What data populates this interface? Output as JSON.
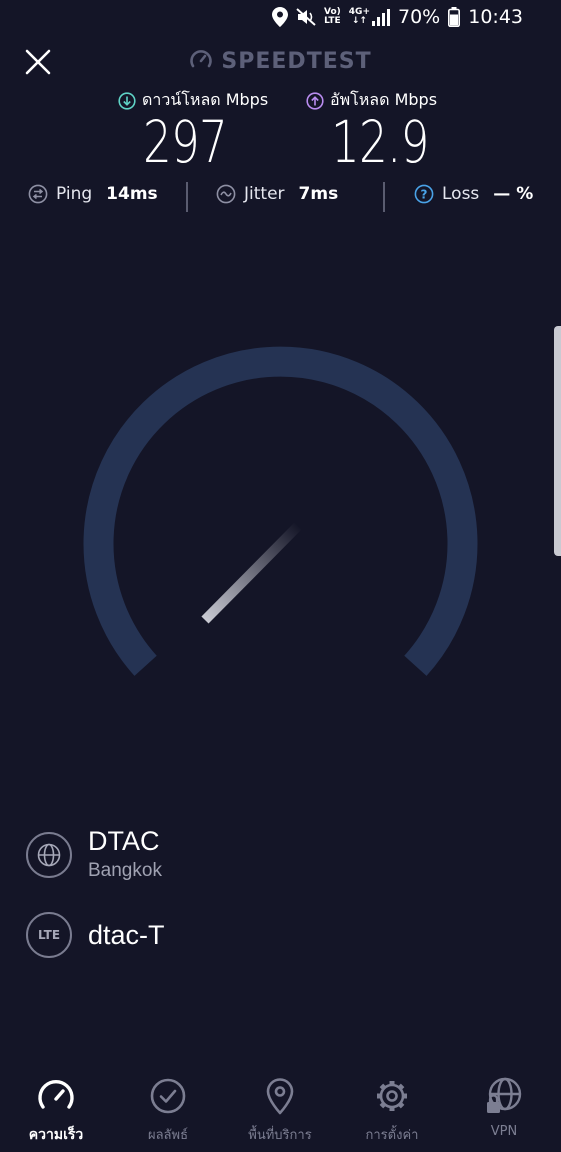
{
  "status_bar": {
    "battery": "70%",
    "time": "10:43",
    "volte_top": "Vo)",
    "volte_bottom": "LTE",
    "network_type": "4G+"
  },
  "header": {
    "brand": "SPEEDTEST"
  },
  "download": {
    "label": "ดาวน์โหลด Mbps",
    "value": "297"
  },
  "upload": {
    "label": "อัพโหลด Mbps",
    "value": "12.9"
  },
  "stats": {
    "ping_label": "Ping",
    "ping_value": "14ms",
    "jitter_label": "Jitter",
    "jitter_value": "7ms",
    "loss_label": "Loss",
    "loss_value": "— %"
  },
  "server": {
    "provider": "DTAC",
    "location": "Bangkok",
    "connection_badge": "LTE",
    "connection_name": "dtac-T"
  },
  "nav": {
    "items": [
      {
        "label": "ความเร็ว",
        "icon": "speedometer-icon"
      },
      {
        "label": "ผลลัพธ์",
        "icon": "check-circle-icon"
      },
      {
        "label": "พื้นที่บริการ",
        "icon": "map-pin-icon"
      },
      {
        "label": "การตั้งค่า",
        "icon": "gear-icon"
      },
      {
        "label": "VPN",
        "icon": "globe-lock-icon"
      }
    ]
  },
  "colors": {
    "background": "#141527",
    "gauge_track": "#253353",
    "download_accent": "#5fd3c6",
    "upload_accent": "#b98cf0",
    "loss_accent": "#4aa3e8"
  }
}
